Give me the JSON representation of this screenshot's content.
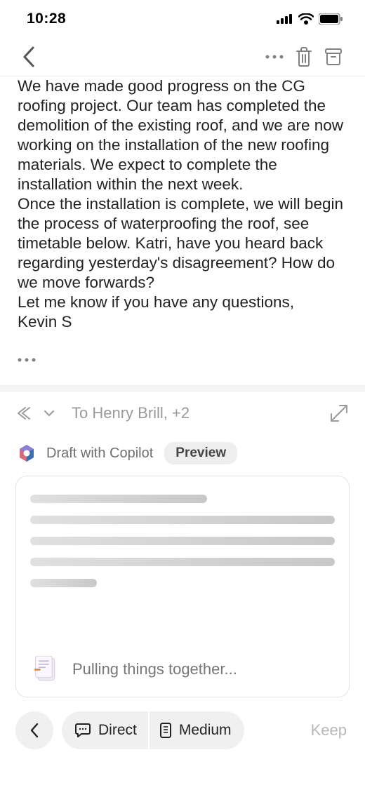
{
  "status": {
    "time": "10:28"
  },
  "email": {
    "para1": "We have made good progress on the CG roofing project. Our team has completed the demolition of the existing roof, and we are now working on the installation of the new roofing materials. We expect to complete the installation within the next week.",
    "para2": "Once the installation is complete, we will begin the process of waterproofing the roof, see timetable below. Katri, have you heard back regarding yesterday's disagreement? How do we move forwards?",
    "para3": "Let me know if you have any questions,",
    "signature": "Kevin S"
  },
  "compose": {
    "to": "To Henry Brill, +2"
  },
  "copilot": {
    "label": "Draft with Copilot",
    "badge": "Preview",
    "status": "Pulling things together..."
  },
  "bottom": {
    "tone": "Direct",
    "length": "Medium",
    "keep": "Keep"
  }
}
